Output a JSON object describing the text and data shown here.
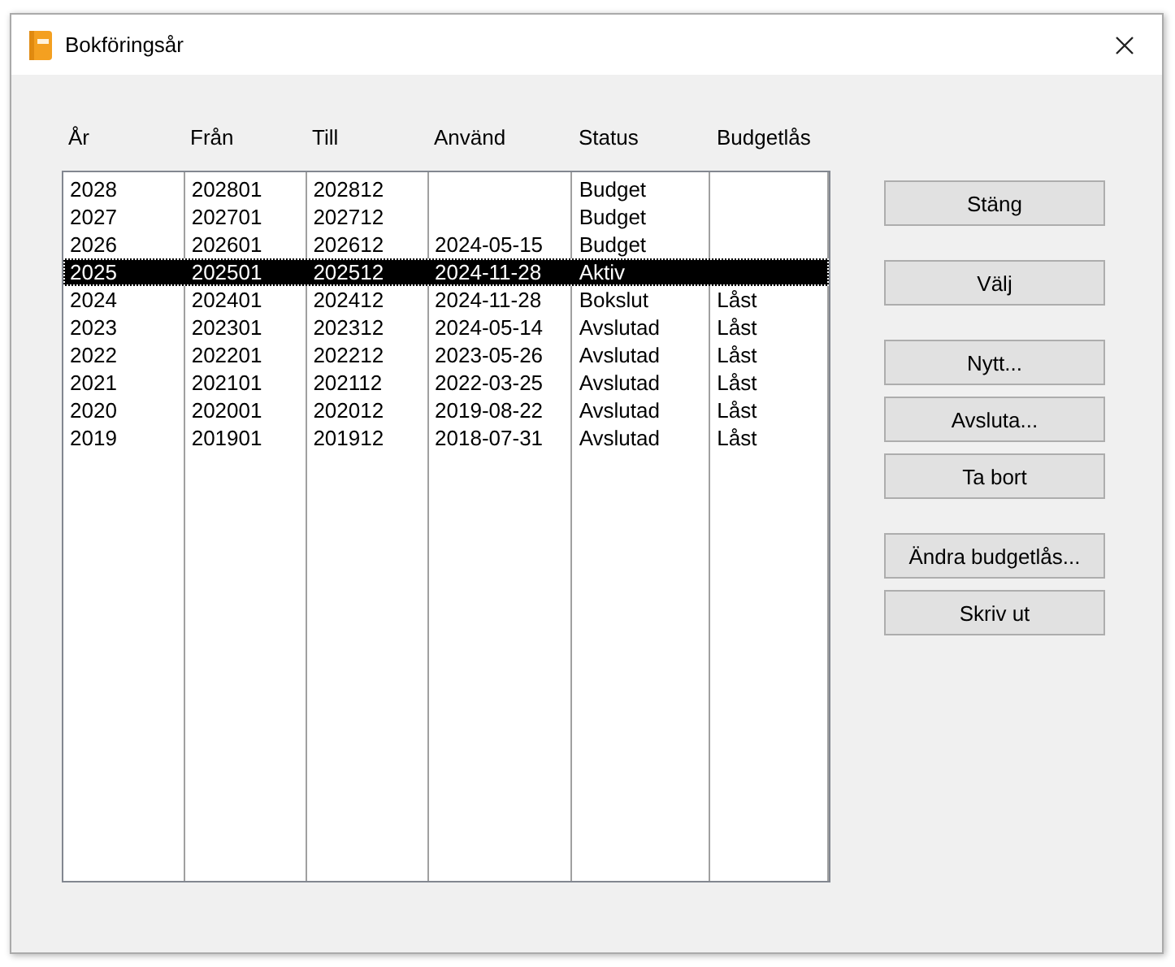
{
  "window": {
    "title": "Bokföringsår"
  },
  "table": {
    "columns": [
      "År",
      "Från",
      "Till",
      "Använd",
      "Status",
      "Budgetlås"
    ],
    "rows": [
      {
        "cells": [
          "2028",
          "202801",
          "202812",
          "",
          "Budget",
          ""
        ],
        "selected": false
      },
      {
        "cells": [
          "2027",
          "202701",
          "202712",
          "",
          "Budget",
          ""
        ],
        "selected": false
      },
      {
        "cells": [
          "2026",
          "202601",
          "202612",
          "2024-05-15",
          "Budget",
          ""
        ],
        "selected": false
      },
      {
        "cells": [
          "2025",
          "202501",
          "202512",
          "2024-11-28",
          "Aktiv",
          ""
        ],
        "selected": true
      },
      {
        "cells": [
          "2024",
          "202401",
          "202412",
          "2024-11-28",
          "Bokslut",
          "Låst"
        ],
        "selected": false
      },
      {
        "cells": [
          "2023",
          "202301",
          "202312",
          "2024-05-14",
          "Avslutad",
          "Låst"
        ],
        "selected": false
      },
      {
        "cells": [
          "2022",
          "202201",
          "202212",
          "2023-05-26",
          "Avslutad",
          "Låst"
        ],
        "selected": false
      },
      {
        "cells": [
          "2021",
          "202101",
          "202112",
          "2022-03-25",
          "Avslutad",
          "Låst"
        ],
        "selected": false
      },
      {
        "cells": [
          "2020",
          "202001",
          "202012",
          "2019-08-22",
          "Avslutad",
          "Låst"
        ],
        "selected": false
      },
      {
        "cells": [
          "2019",
          "201901",
          "201912",
          "2018-07-31",
          "Avslutad",
          "Låst"
        ],
        "selected": false
      }
    ]
  },
  "button_groups": [
    [
      {
        "label": "Stäng"
      }
    ],
    [
      {
        "label": "Välj"
      }
    ],
    [
      {
        "label": "Nytt..."
      },
      {
        "label": "Avsluta..."
      },
      {
        "label": "Ta bort"
      }
    ],
    [
      {
        "label": "Ändra budgetlås..."
      },
      {
        "label": "Skriv ut"
      }
    ]
  ]
}
